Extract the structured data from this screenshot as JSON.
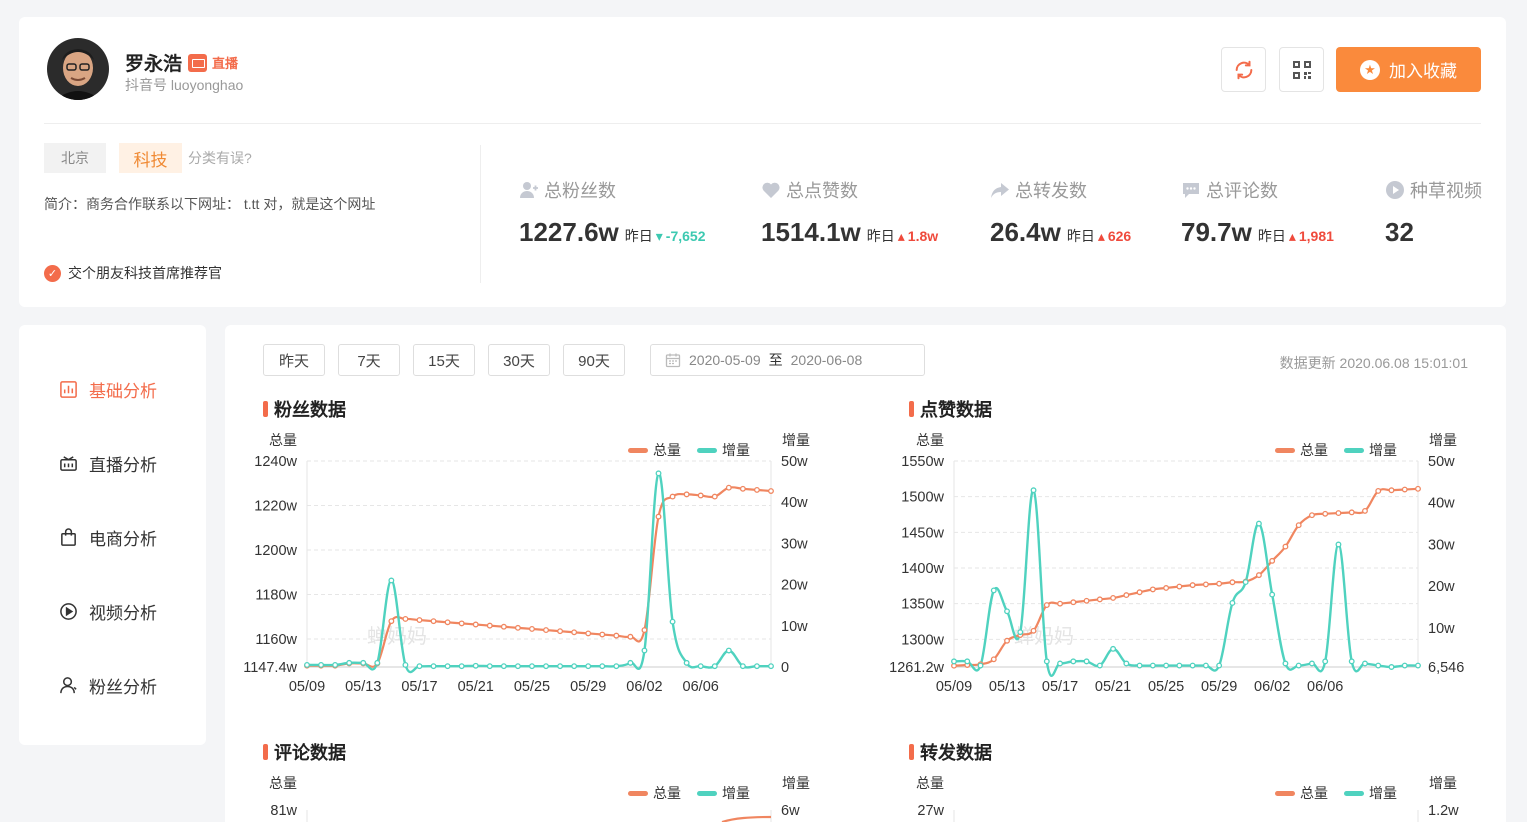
{
  "profile": {
    "name": "罗永浩",
    "live_text": "直播",
    "douyin_id": "抖音号 luoyonghao",
    "city": "北京",
    "category": "科技",
    "category_wrong": "分类有误?",
    "intro": "简介：商务合作联系以下网址： t.tt 对，就是这个网址",
    "verify": "交个朋友科技首席推荐官",
    "fav_label": "加入收藏"
  },
  "stats": [
    {
      "label": "总粉丝数",
      "value": "1227.6w",
      "yesterday": "昨日",
      "arrow": "▾",
      "delta": "-7,652",
      "dir": "down"
    },
    {
      "label": "总点赞数",
      "value": "1514.1w",
      "yesterday": "昨日",
      "arrow": "▴",
      "delta": "1.8w",
      "dir": "up"
    },
    {
      "label": "总转发数",
      "value": "26.4w",
      "yesterday": "昨日",
      "arrow": "▴",
      "delta": "626",
      "dir": "up"
    },
    {
      "label": "总评论数",
      "value": "79.7w",
      "yesterday": "昨日",
      "arrow": "▴",
      "delta": "1,981",
      "dir": "up"
    },
    {
      "label": "种草视频",
      "value": "32"
    }
  ],
  "sidebar": [
    {
      "label": "基础分析",
      "active": true
    },
    {
      "label": "直播分析"
    },
    {
      "label": "电商分析"
    },
    {
      "label": "视频分析"
    },
    {
      "label": "粉丝分析"
    }
  ],
  "ranges": [
    "昨天",
    "7天",
    "15天",
    "30天",
    "90天"
  ],
  "date_range": {
    "start": "2020-05-09",
    "sep": "至",
    "end": "2020-06-08"
  },
  "update_time": "数据更新 2020.06.08 15:01:01",
  "watermark": "蝉妈妈",
  "colors": {
    "total": "#f08660",
    "incr": "#4fd2bf",
    "accent": "#f36c4b",
    "fav": "#fa8a3c"
  },
  "chart_data": [
    {
      "type": "line",
      "title": "粉丝数据",
      "left_axis_title": "总量",
      "right_axis_title": "增量",
      "legend": [
        "总量",
        "增量"
      ],
      "x_ticks": [
        "05/09",
        "05/13",
        "05/17",
        "05/21",
        "05/25",
        "05/29",
        "06/02",
        "06/06"
      ],
      "left_ticks": [
        "1240w",
        "1220w",
        "1200w",
        "1180w",
        "1160w",
        "1147.4w"
      ],
      "left_tick_values": [
        1240,
        1220,
        1200,
        1180,
        1160,
        1147.4
      ],
      "right_ticks": [
        "50w",
        "40w",
        "30w",
        "20w",
        "10w",
        "0"
      ],
      "right_tick_values": [
        50,
        40,
        30,
        20,
        10,
        0
      ],
      "ylim_left": [
        1147.4,
        1240
      ],
      "ylim_right": [
        0,
        50
      ],
      "series": [
        {
          "name": "总量",
          "values": [
            1148,
            1148,
            1148,
            1149,
            1149,
            1149,
            1168,
            1169,
            1168.5,
            1168,
            1167.5,
            1167,
            1166.5,
            1166,
            1165.5,
            1165,
            1164.5,
            1164,
            1163.5,
            1163,
            1162.5,
            1162,
            1161.5,
            1161,
            1164,
            1215,
            1224,
            1225,
            1224.5,
            1224,
            1228,
            1227.5,
            1227,
            1226.5
          ]
        },
        {
          "name": "增量",
          "values": [
            0.5,
            0.5,
            0.5,
            1,
            1,
            1,
            21,
            0.5,
            0.2,
            0.2,
            0.2,
            0.2,
            0.3,
            0.2,
            0.2,
            0.2,
            0.2,
            0.2,
            0.2,
            0.2,
            0.2,
            0.2,
            0.2,
            1,
            4,
            47,
            11,
            1,
            0.2,
            0.2,
            4,
            0.2,
            0.2,
            0.2
          ]
        }
      ]
    },
    {
      "type": "line",
      "title": "点赞数据",
      "left_axis_title": "总量",
      "right_axis_title": "增量",
      "legend": [
        "总量",
        "增量"
      ],
      "x_ticks": [
        "05/09",
        "05/13",
        "05/17",
        "05/21",
        "05/25",
        "05/29",
        "06/02",
        "06/06"
      ],
      "left_ticks": [
        "1550w",
        "1500w",
        "1450w",
        "1400w",
        "1350w",
        "1300w",
        "1261.2w"
      ],
      "left_tick_values": [
        1550,
        1500,
        1450,
        1400,
        1350,
        1300,
        1261.2
      ],
      "right_ticks": [
        "50w",
        "40w",
        "30w",
        "20w",
        "10w",
        "6,546"
      ],
      "right_tick_values": [
        50,
        40,
        30,
        20,
        10,
        0.6546
      ],
      "ylim_left": [
        1261.2,
        1550
      ],
      "ylim_right": [
        0.6546,
        50
      ],
      "series": [
        {
          "name": "总量",
          "values": [
            1263,
            1264,
            1265,
            1272,
            1298,
            1306,
            1312,
            1348,
            1350,
            1352,
            1354,
            1356,
            1358,
            1362,
            1366,
            1370,
            1372,
            1374,
            1376,
            1377,
            1378,
            1380,
            1381,
            1390,
            1410,
            1430,
            1460,
            1474,
            1476,
            1477,
            1478,
            1480,
            1508,
            1509,
            1510,
            1511
          ]
        },
        {
          "name": "增量",
          "values": [
            2,
            2,
            1,
            19,
            14,
            9,
            43,
            2,
            1.5,
            2,
            2,
            1,
            5,
            1.5,
            1,
            1,
            1,
            1,
            1,
            1,
            1,
            16,
            21,
            35,
            18,
            1.5,
            1,
            1.5,
            2,
            30,
            2,
            1.5,
            1,
            0.6546,
            1,
            1
          ]
        }
      ]
    },
    {
      "type": "line",
      "title": "评论数据",
      "left_axis_title": "总量",
      "right_axis_title": "增量",
      "legend": [
        "总量",
        "增量"
      ],
      "left_ticks": [
        "81w"
      ],
      "right_ticks": [
        "6w"
      ]
    },
    {
      "type": "line",
      "title": "转发数据",
      "left_axis_title": "总量",
      "right_axis_title": "增量",
      "legend": [
        "总量",
        "增量"
      ],
      "left_ticks": [
        "27w"
      ],
      "right_ticks": [
        "1.2w"
      ]
    }
  ]
}
